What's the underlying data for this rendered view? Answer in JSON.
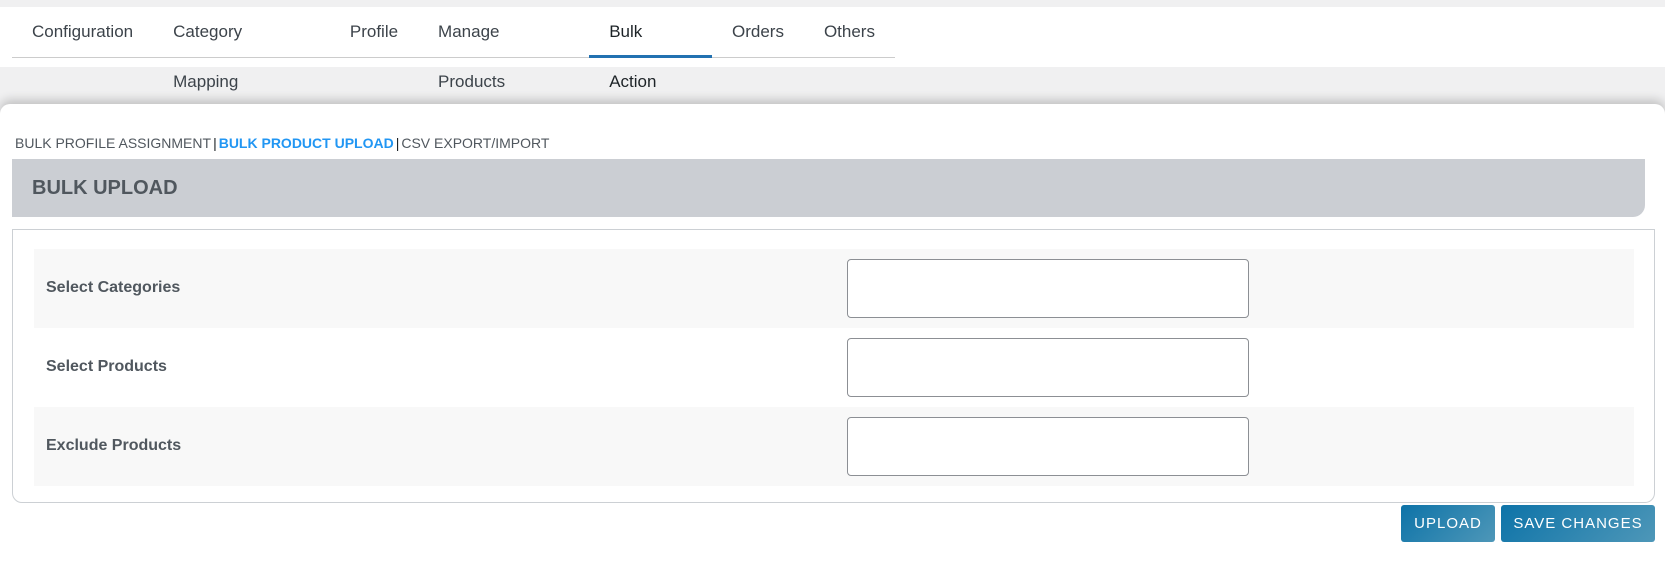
{
  "tabs": [
    "Configuration",
    "Category Mapping",
    "Profile",
    "Manage Products",
    "Bulk Action",
    "Orders",
    "Others"
  ],
  "active_tab": "Bulk Action",
  "subnav": {
    "bulk_profile": "BULK PROFILE ASSIGNMENT",
    "bulk_upload": "BULK PRODUCT UPLOAD",
    "csv": "CSV EXPORT/IMPORT",
    "sep": "|"
  },
  "section_title": "BULK UPLOAD",
  "fields": [
    {
      "label": "Select Categories",
      "value": ""
    },
    {
      "label": "Select Products",
      "value": ""
    },
    {
      "label": "Exclude Products",
      "value": ""
    }
  ],
  "buttons": {
    "upload": "UPLOAD",
    "save": "SAVE CHANGES"
  }
}
